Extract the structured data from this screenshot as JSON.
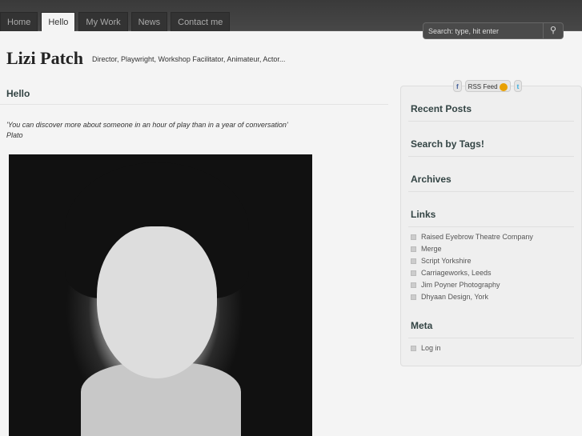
{
  "nav": {
    "items": [
      "Home",
      "Hello",
      "My Work",
      "News",
      "Contact me"
    ],
    "active": "Hello"
  },
  "search": {
    "placeholder": "Search: type, hit enter"
  },
  "site": {
    "title": "Lizi Patch",
    "tagline": "Director, Playwright, Workshop Facilitator, Animateur, Actor..."
  },
  "page": {
    "heading": "Hello",
    "quote": "'You can discover more about someone in an hour of play than in a year of conversation'",
    "quote_author": "Plato"
  },
  "social": {
    "facebook": "f",
    "rss": "RSS Feed",
    "twitter": "t"
  },
  "sidebar": {
    "recent_posts": "Recent Posts",
    "tags": "Search by Tags!",
    "archives": "Archives",
    "links_title": "Links",
    "links": [
      "Raised Eyebrow Theatre Company",
      "Merge",
      "Script Yorkshire",
      "Carriageworks, Leeds",
      "Jim Poyner Photography",
      "Dhyaan Design, York"
    ],
    "meta_title": "Meta",
    "meta": [
      "Log in"
    ]
  }
}
